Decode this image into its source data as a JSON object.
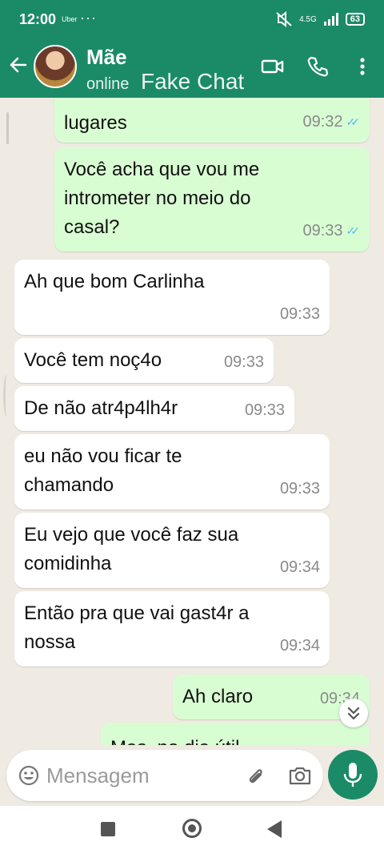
{
  "status_bar": {
    "time": "12:00",
    "carrier": "Uber",
    "dots": "···",
    "network": "4.5G",
    "battery": "63"
  },
  "header": {
    "contact_name": "Mãe",
    "contact_status": "online",
    "watermark": "Fake Chat"
  },
  "messages": [
    {
      "direction": "out",
      "text": "lugares",
      "time": "09:32"
    },
    {
      "direction": "out",
      "text": "Você acha que vou me intrometer no meio do casal?",
      "time": "09:33"
    },
    {
      "direction": "in",
      "text": "Ah que bom Carlinha",
      "time": "09:33"
    },
    {
      "direction": "in",
      "text": "Você tem noç4o",
      "time": "09:33"
    },
    {
      "direction": "in",
      "text": "De não atr4p4lh4r",
      "time": "09:33"
    },
    {
      "direction": "in",
      "text": "eu não vou ficar te chamando",
      "time": "09:33"
    },
    {
      "direction": "in",
      "text": "Eu vejo que você faz sua comidinha",
      "time": "09:34"
    },
    {
      "direction": "in",
      "text": "Então pra que vai gast4r a nossa",
      "time": "09:34"
    },
    {
      "direction": "out",
      "text": "Ah claro",
      "time": "09:34"
    },
    {
      "direction": "out",
      "text": "Mas, no dia útil",
      "time": ""
    }
  ],
  "composer": {
    "placeholder": "Mensagem"
  },
  "colors": {
    "header_green": "#1b8a67",
    "outgoing_bubble": "#d9fdd3",
    "incoming_bubble": "#ffffff",
    "read_ticks": "#53bdeb",
    "chat_background": "#efeae2"
  },
  "icons": [
    "back-arrow-icon",
    "video-call-icon",
    "phone-icon",
    "more-vert-icon",
    "emoji-icon",
    "attach-icon",
    "camera-icon",
    "mic-icon",
    "scroll-down-icon"
  ]
}
